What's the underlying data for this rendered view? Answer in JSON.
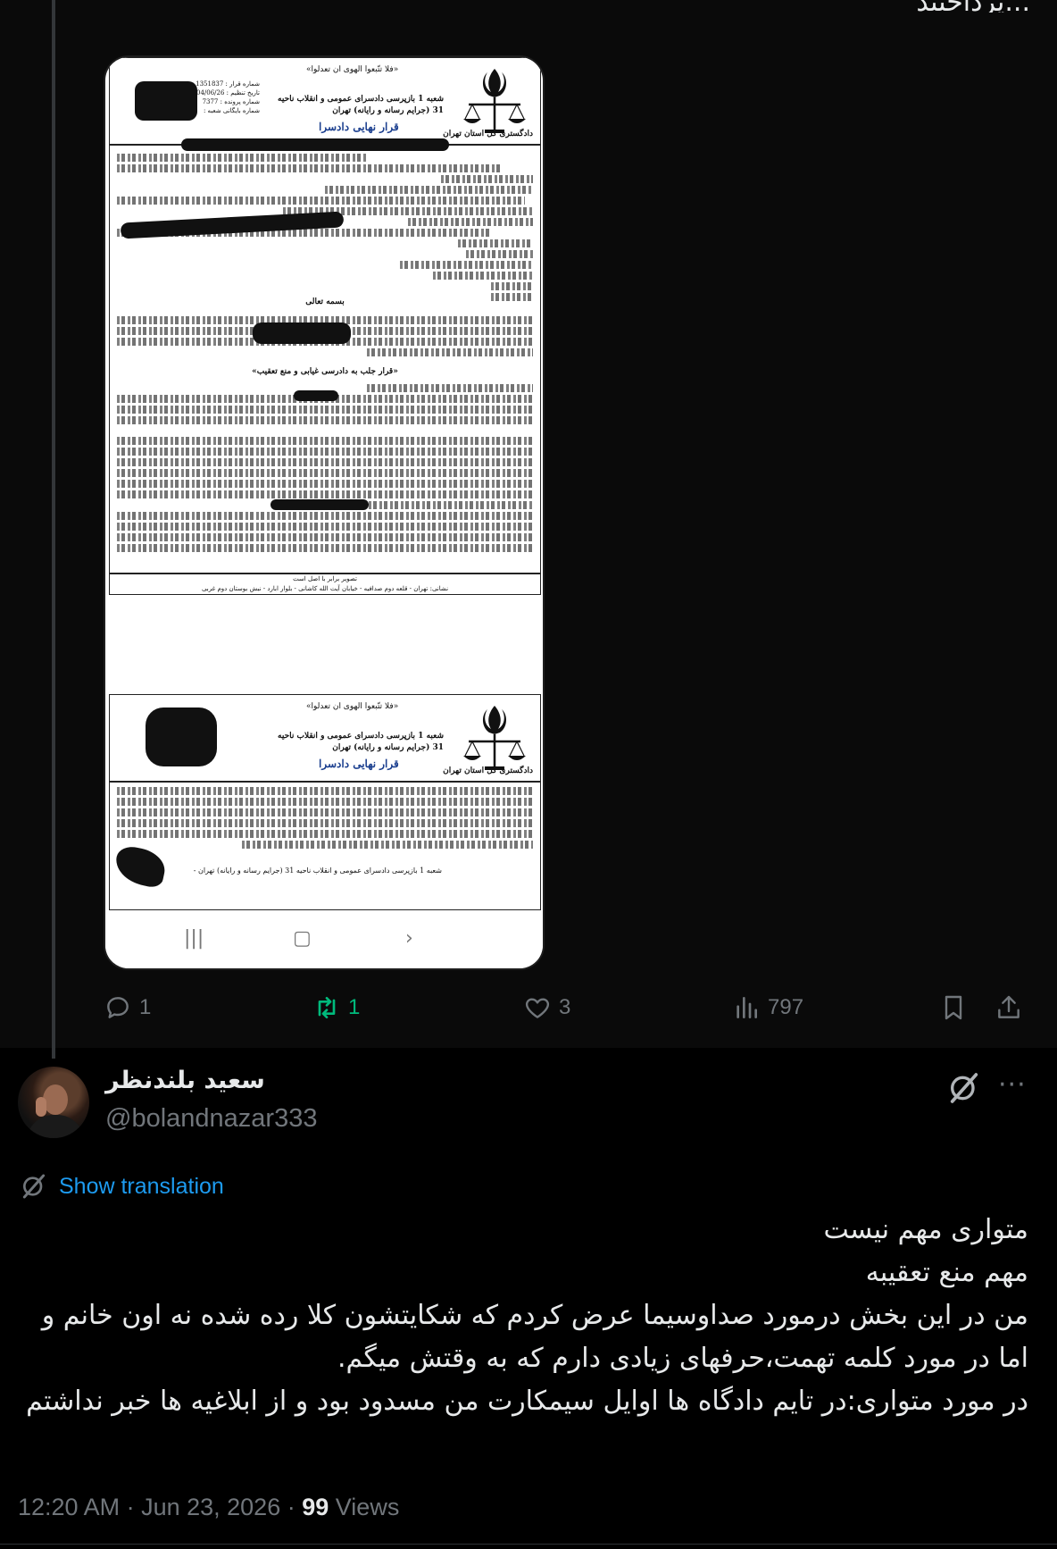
{
  "prev_tweet": {
    "text_fragment": "پرداختید..."
  },
  "document": {
    "bismillah": "«فلا تتّبعوا الهوی ان تعدلوا»",
    "court_name": "دادگستری کل استان تهران",
    "branch": "شعبه 1 بازپرسی دادسرای عمومی و انقلاب ناحیه 31 (جرایم رسانه و رایانه) تهران",
    "title": "قرار نهایی دادسرا",
    "meta_1": "شماره قرار : 1351837",
    "meta_2": "تاریخ تنظیم : 1404/06/26",
    "meta_3": "شماره پرونده : 7377",
    "meta_4": "شماره بایگانی شعبه :",
    "bessmeh": "بسمه تعالی",
    "decision_heading": "«قرار جلب به دادرسی غیابی و منع تعقیب»",
    "footer_1": "تصویر برابر با اصل است",
    "footer_2": "نشانی: تهران - قلعه دوم صدافیه - خیابان آیت الله کاشانی - بلوار ابارد - نبش بوستان دوم غربی",
    "page2_branch_line": "شعبه 1 بازپرسی دادسرای عمومی و انقلاب ناحیه 31 (جرایم رسانه و رایانه) تهران -"
  },
  "actions": {
    "replies": "1",
    "reposts": "1",
    "likes": "3",
    "views": "797"
  },
  "tweet": {
    "display_name": "سعید بلندنظر",
    "handle": "@bolandnazar333",
    "show_translation": "Show translation",
    "lines": [
      "متواری مهم نیست",
      "مهم منع تعقیبه",
      "من در این بخش درمورد صداوسیما عرض کردم که شکایتشون کلا رده شده نه اون خانم و اما در مورد کلمه تهمت،حرفهای زیادی دارم که به وقتش میگم.",
      "در مورد متواری:در تایم دادگاه ها اوایل سیمکارت من مسدود بود و از ابلاغیه ها خبر نداشتم"
    ],
    "timestamp": "12:20 AM · Jun 23, 2026 ·",
    "views_count": "99",
    "views_label": "Views"
  },
  "colors": {
    "accent": "#1d9bf0",
    "repost_green": "#00ba7c",
    "muted": "#71767b"
  }
}
